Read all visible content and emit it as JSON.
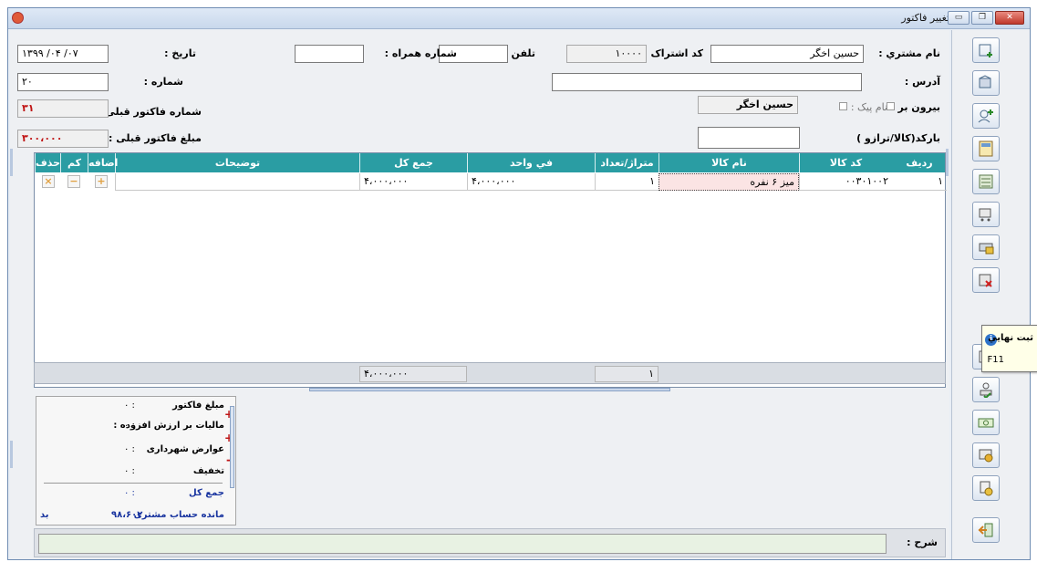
{
  "window": {
    "title": "تغيير فاكتور"
  },
  "header": {
    "customer_label": "نام مشتري :",
    "customer_value": "حسين اخگر",
    "subscription_label": "کد اشتراک :",
    "subscription_value": "۱۰۰۰۰",
    "phone_label": "تلفن :",
    "phone_value": "",
    "mobile_label": "شماره همراه :",
    "mobile_value": "",
    "date_label": "تاريخ :",
    "date_value": "۱۳۹۹ /۰۴ /۰۷",
    "address_label": "آدرس :",
    "address_value": "",
    "number_label": "شماره :",
    "number_value": "۲۰",
    "outside_label": "بيرون بر",
    "courier_label": "نام پيک :",
    "salesman_value": "حسين اخگر",
    "prev_invoice_number_label": "شماره فاکتور قبلی :",
    "prev_invoice_number_value": "۳۱",
    "barcode_label": "بارکد(کالا/ترازو )",
    "barcode_value": "",
    "prev_invoice_amount_label": "مبلغ فاکتور قبلی :",
    "prev_invoice_amount_value": "۳۰۰،۰۰۰"
  },
  "table": {
    "columns": [
      "رديف",
      "کد کالا",
      "نام کالا",
      "متراژ/تعداد",
      "في واحد",
      "جمع کل",
      "توضيحات",
      "اضافه",
      "کم",
      "حذف"
    ],
    "rows": [
      {
        "row": "۱",
        "code": "۰۰۳۰۱۰۰۲",
        "name": "ميز ۶ نفره",
        "qty": "۱",
        "unit_price": "۴،۰۰۰،۰۰۰",
        "total": "۴،۰۰۰،۰۰۰",
        "desc": ""
      }
    ],
    "totals": {
      "total": "۴،۰۰۰،۰۰۰",
      "qty": "۱"
    }
  },
  "summary": {
    "invoice_amount_label": "مبلغ فاکتور",
    "invoice_amount_value": "۰ :",
    "vat_label": "ماليات بر ارزش افزوده :",
    "vat_value": "۰ :",
    "municipal_label": "عوارض شهرداری",
    "municipal_value": "۰ :",
    "discount_label": "تخفيف",
    "discount_value": "۰ :",
    "grand_total_label": "جمع کل",
    "grand_total_value": "۰ :",
    "balance_label": "مانده حساب مشتری",
    "balance_value": "۹۸،۶۰۲",
    "balance_status": "بد"
  },
  "footer": {
    "sharh_label": "شرح :",
    "sharh_value": ""
  },
  "tooltip": {
    "title": "ثبت نهايي",
    "shortcut": "F11"
  },
  "colors": {
    "grid_header": "#2a9da3",
    "accent_red": "#c01515",
    "accent_blue": "#1a35a0"
  }
}
